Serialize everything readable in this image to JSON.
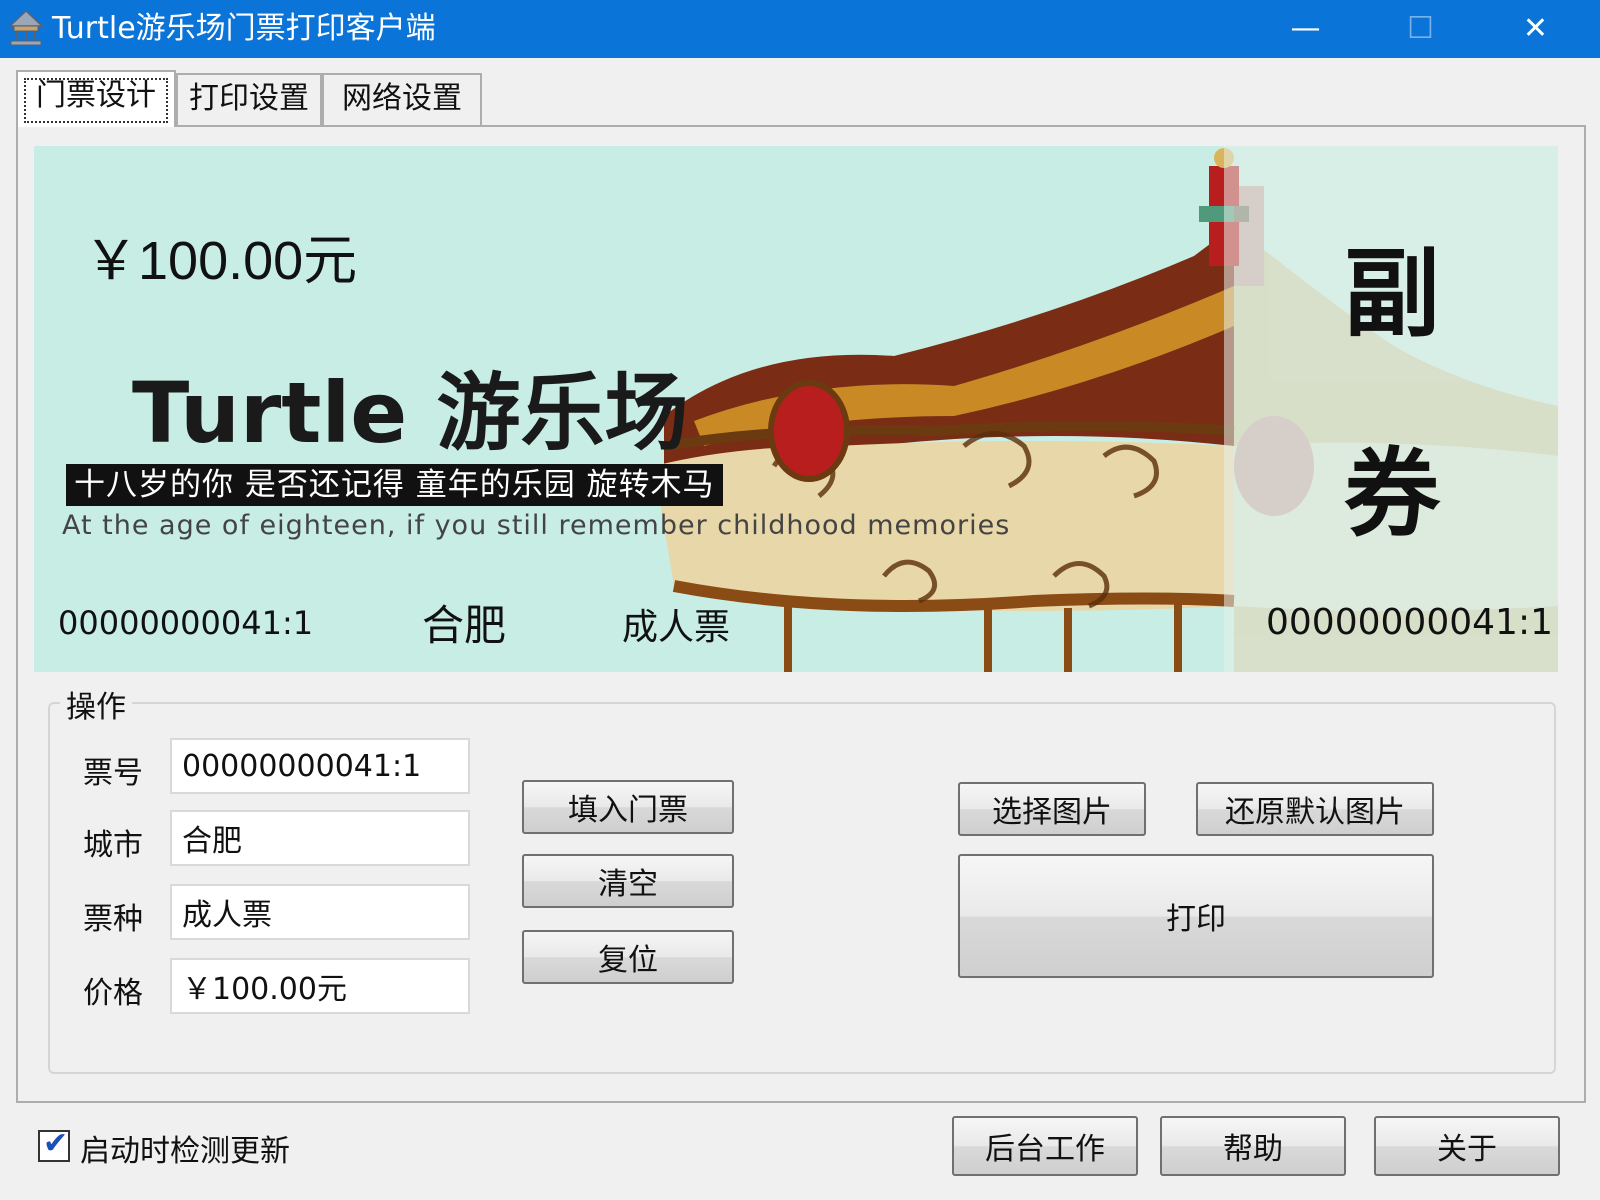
{
  "window": {
    "title": "Turtle游乐场门票打印客户端",
    "minimize_glyph": "—",
    "maximize_glyph": "☐",
    "close_glyph": "✕"
  },
  "tabs": [
    {
      "label": "门票设计",
      "active": true
    },
    {
      "label": "打印设置",
      "active": false
    },
    {
      "label": "网络设置",
      "active": false
    }
  ],
  "ticket": {
    "price": "￥100.00元",
    "title": "Turtle 游乐场",
    "slogan_cn": "十八岁的你  是否还记得  童年的乐园  旋转木马",
    "slogan_en": "At the age of eighteen, if you still remember childhood memories",
    "number": "00000000041:1",
    "city": "合肥",
    "type": "成人票",
    "stub_char_1": "副",
    "stub_char_2": "券",
    "stub_number": "00000000041:1",
    "background_color": "#c7ede5"
  },
  "operations": {
    "group_title": "操作",
    "fields": {
      "ticket_no_label": "票号",
      "ticket_no_value": "00000000041:1",
      "city_label": "城市",
      "city_value": "合肥",
      "type_label": "票种",
      "type_value": "成人票",
      "price_label": "价格",
      "price_value": "￥100.00元"
    },
    "buttons": {
      "fill": "填入门票",
      "clear": "清空",
      "reset": "复位",
      "select_image": "选择图片",
      "restore_image": "还原默认图片",
      "print": "打印"
    }
  },
  "footer": {
    "check_update_label": "启动时检测更新",
    "check_update_checked": true,
    "background_btn": "后台工作",
    "help_btn": "帮助",
    "about_btn": "关于"
  },
  "colors": {
    "titlebar": "#0a74d8",
    "window_bg": "#f0f0f0"
  }
}
